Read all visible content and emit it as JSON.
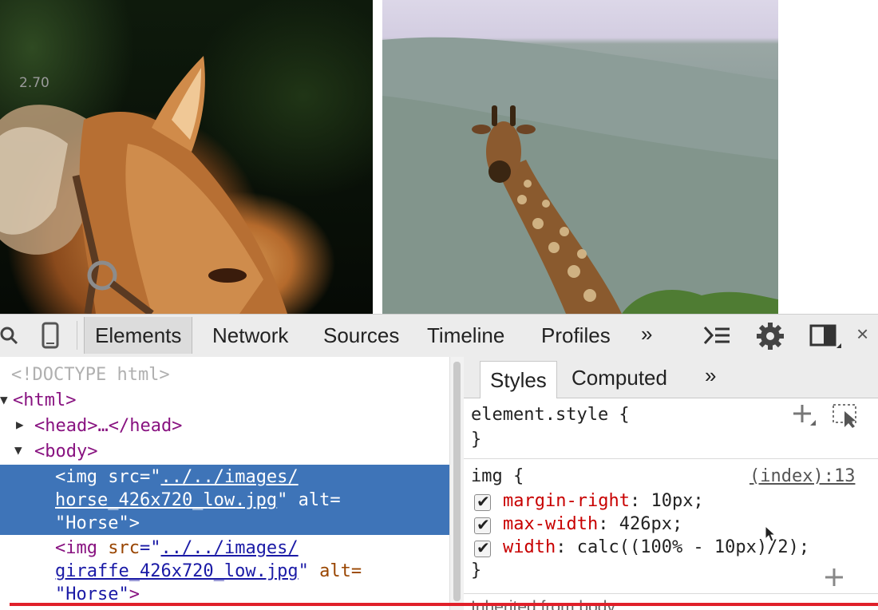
{
  "preview": {
    "fps_label": "2.70"
  },
  "toolbar": {
    "tabs": [
      "Elements",
      "Network",
      "Sources",
      "Timeline",
      "Profiles"
    ],
    "more": "»",
    "close": "×"
  },
  "elements": {
    "doctype": "<!DOCTYPE html>",
    "html_open": "<html>",
    "head": "<head>…</head>",
    "body_open": "<body>",
    "img1": {
      "tag_open": "<img",
      "src_attr": "src",
      "eq_quote": "=\"",
      "src_line1": "../../images/",
      "src_line2": "horse_426x720_low.jpg",
      "close_quote": "\"",
      "alt_attr": "alt",
      "alt_eq": "=",
      "alt_value": "\"Horse\"",
      "tag_close": ">"
    },
    "img2": {
      "tag_open": "<img",
      "src_attr": "src",
      "eq_quote": "=\"",
      "src_line1": "../../images/",
      "src_line2": "giraffe_426x720_low.jpg",
      "close_quote": "\"",
      "alt_attr": "alt",
      "alt_eq": "=",
      "alt_value": "\"Horse\"",
      "tag_close": ">"
    }
  },
  "styles": {
    "tabs": [
      "Styles",
      "Computed"
    ],
    "more": "»",
    "element_style_selector": "element.style {",
    "close_brace": "}",
    "img_rule": {
      "selector": "img {",
      "source": "(index):13",
      "declarations": [
        {
          "property": "margin-right",
          "value": "10px;",
          "checked": true
        },
        {
          "property": "max-width",
          "value": "426px;",
          "checked": true
        },
        {
          "property": "width",
          "value": "calc((100% - 10px)/2);",
          "checked": true
        }
      ]
    },
    "inherited_label": "Inherited from body"
  }
}
